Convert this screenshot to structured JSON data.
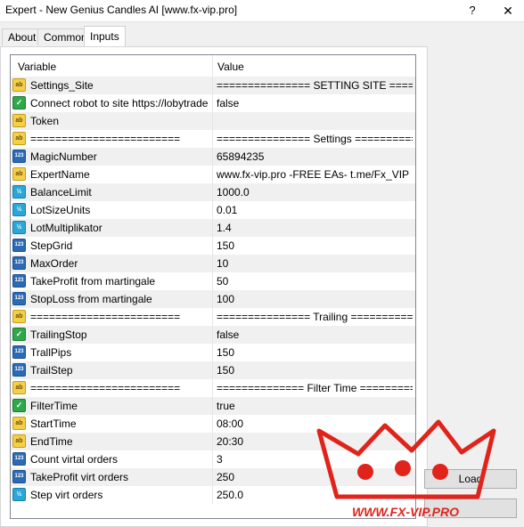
{
  "window": {
    "title": "Expert - New Genius Candles AI [www.fx-vip.pro]",
    "help": "?",
    "close": "✕"
  },
  "tabs": [
    "About",
    "Common",
    "Inputs"
  ],
  "grid": {
    "headers": {
      "variable": "Variable",
      "value": "Value"
    },
    "rows": [
      {
        "icon": "ab",
        "name": "Settings_Site",
        "value": "=============== SETTING SITE ======..."
      },
      {
        "icon": "bool",
        "name": "Connect robot to site https://lobytrade....",
        "value": "false"
      },
      {
        "icon": "ab",
        "name": "Token",
        "value": ""
      },
      {
        "icon": "ab",
        "name": "========================",
        "value": "=============== Settings ============..."
      },
      {
        "icon": "123",
        "name": "MagicNumber",
        "value": "65894235"
      },
      {
        "icon": "ab",
        "name": "ExpertName",
        "value": "www.fx-vip.pro   -FREE EAs-   t.me/Fx_VIP"
      },
      {
        "icon": "half",
        "name": "BalanceLimit",
        "value": "1000.0"
      },
      {
        "icon": "half",
        "name": "LotSizeUnits",
        "value": "0.01"
      },
      {
        "icon": "half",
        "name": "LotMultiplikator",
        "value": "1.4"
      },
      {
        "icon": "123",
        "name": "StepGrid",
        "value": "150"
      },
      {
        "icon": "123",
        "name": "MaxOrder",
        "value": "10"
      },
      {
        "icon": "123",
        "name": "TakeProfit from martingale",
        "value": "50"
      },
      {
        "icon": "123",
        "name": "StopLoss from martingale",
        "value": "100"
      },
      {
        "icon": "ab",
        "name": "========================",
        "value": "=============== Trailing ==============="
      },
      {
        "icon": "bool",
        "name": "TrailingStop",
        "value": "false"
      },
      {
        "icon": "123",
        "name": "TrallPips",
        "value": "150"
      },
      {
        "icon": "123",
        "name": "TrailStep",
        "value": "150"
      },
      {
        "icon": "ab",
        "name": "========================",
        "value": "============== Filter Time ===========..."
      },
      {
        "icon": "bool",
        "name": "FilterTime",
        "value": "true"
      },
      {
        "icon": "ab",
        "name": "StartTime",
        "value": "08:00"
      },
      {
        "icon": "ab",
        "name": "EndTime",
        "value": "20:30"
      },
      {
        "icon": "123",
        "name": "Count virtal orders",
        "value": "3"
      },
      {
        "icon": "123",
        "name": "TakeProfit virt orders",
        "value": "250"
      },
      {
        "icon": "half",
        "name": "Step virt orders",
        "value": "250.0"
      }
    ]
  },
  "buttons": {
    "load": "Load",
    "save": ""
  },
  "watermark": {
    "text": "WWW.FX-VIP.PRO",
    "color": "#e0241b"
  }
}
